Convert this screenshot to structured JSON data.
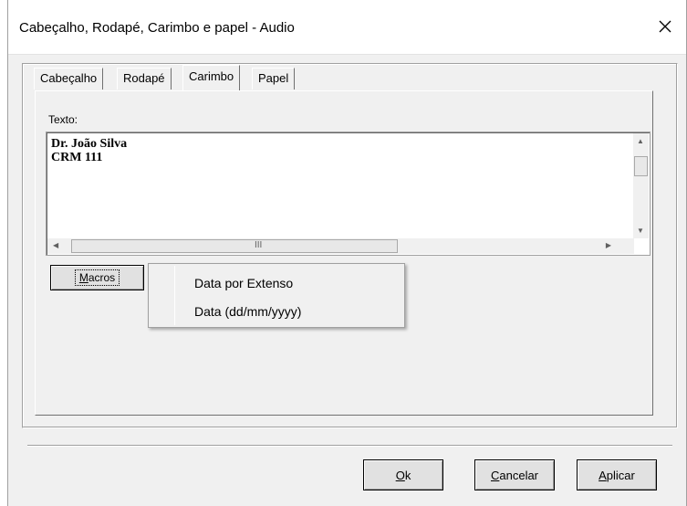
{
  "window": {
    "title": "Cabeçalho, Rodapé, Carimbo e papel - Audio"
  },
  "tabs": [
    {
      "label": "Cabeçalho"
    },
    {
      "label": "Rodapé"
    },
    {
      "label": "Carimbo",
      "active": true
    },
    {
      "label": "Papel"
    }
  ],
  "carimbo": {
    "texto_label": "Texto:",
    "texto_value": "Dr. João Silva\nCRM 111",
    "scroll_grip": "III"
  },
  "macros": {
    "button_label_prefix": "",
    "button_mnemonic": "M",
    "button_label_rest": "acros",
    "menu_items": [
      "Data por Extenso",
      "Data (dd/mm/yyyy)"
    ]
  },
  "buttons": {
    "ok_mnemonic": "O",
    "ok_rest": "k",
    "cancel_mnemonic": "C",
    "cancel_rest": "ancelar",
    "apply_mnemonic": "A",
    "apply_rest": "plicar"
  },
  "icons": {
    "close": "close-icon",
    "scroll": "scroll-arrow-icons"
  }
}
